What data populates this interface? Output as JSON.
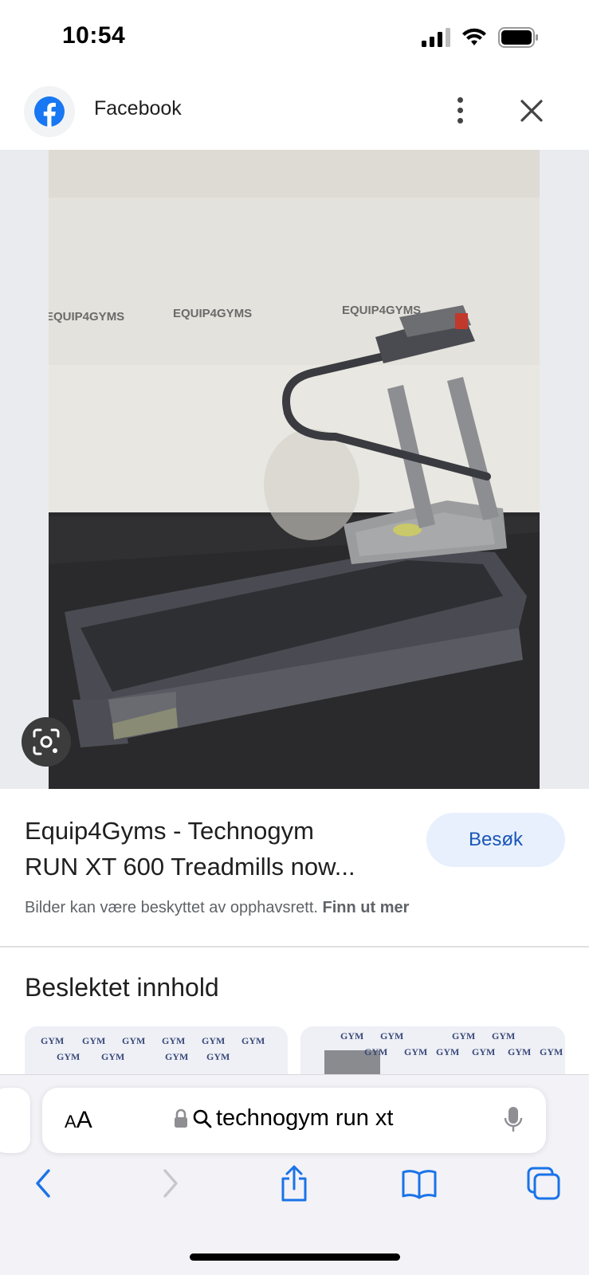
{
  "status_bar": {
    "time": "10:54"
  },
  "header": {
    "source_name": "Facebook"
  },
  "photo": {
    "watermark_1": "EQUIP4GYMS",
    "watermark_2": "EQUIP4GYMS",
    "watermark_3": "EQUIP4GYMS"
  },
  "result": {
    "title_line1": "Equip4Gyms - Technogym",
    "title_line2": "RUN XT 600 Treadmills now...",
    "visit_label": "Besøk",
    "copyright_text": "Bilder kan være beskyttet av opphavsrett.",
    "learn_more": "Finn ut mer"
  },
  "related": {
    "heading": "Beslektet innhold",
    "thumb_text": "GYM"
  },
  "browser": {
    "text_size_label": "A",
    "text_size_label_big": "A",
    "url_text": "technogym run xt"
  },
  "colors": {
    "accent": "#1a73e8",
    "visit_bg": "#e8f0fe",
    "facebook_blue": "#1877f2"
  }
}
